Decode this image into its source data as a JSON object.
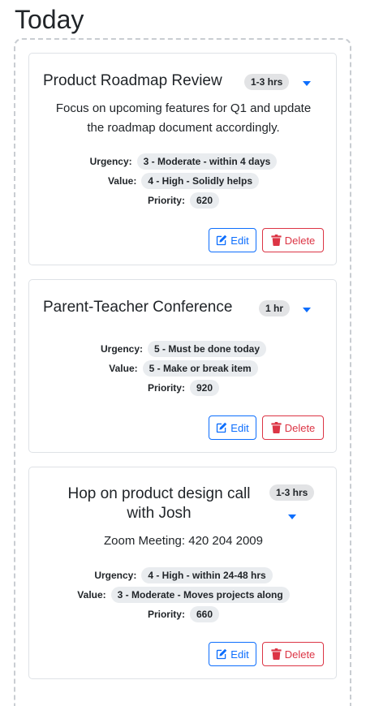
{
  "header": {
    "title": "Today"
  },
  "colors": {
    "primary": "#0d6efd",
    "danger": "#dc3545",
    "badge_bg": "#e2e3e5"
  },
  "cards": [
    {
      "title": "Product Roadmap Review",
      "duration": "1-3 hrs",
      "description_lines": [
        "Focus on upcoming features for Q1 and update",
        "the roadmap document accordingly."
      ],
      "urgency_label": "Urgency:",
      "urgency": "3 - Moderate - within 4 days",
      "value_label": "Value:",
      "value": "4 - High - Solidly helps",
      "priority_label": "Priority:",
      "priority": "620",
      "edit_label": "Edit",
      "delete_label": "Delete",
      "caret_icon": "chevron-down-icon"
    },
    {
      "title": "Parent-Teacher Conference",
      "duration": "1 hr",
      "urgency_label": "Urgency:",
      "urgency": "5 - Must be done today",
      "value_label": "Value:",
      "value": "5 - Make or break item",
      "priority_label": "Priority:",
      "priority": "920",
      "edit_label": "Edit",
      "delete_label": "Delete",
      "caret_icon": "chevron-down-icon"
    },
    {
      "title_lines": [
        "Hop on product design call",
        "with Josh"
      ],
      "duration": "1-3 hrs",
      "description_lines": [
        "Zoom Meeting: 420 204 2009"
      ],
      "urgency_label": "Urgency:",
      "urgency": "4 - High - within 24-48 hrs",
      "value_label": "Value:",
      "value": "3 - Moderate - Moves projects along",
      "priority_label": "Priority:",
      "priority": "660",
      "edit_label": "Edit",
      "delete_label": "Delete",
      "caret_icon": "chevron-down-icon"
    }
  ]
}
